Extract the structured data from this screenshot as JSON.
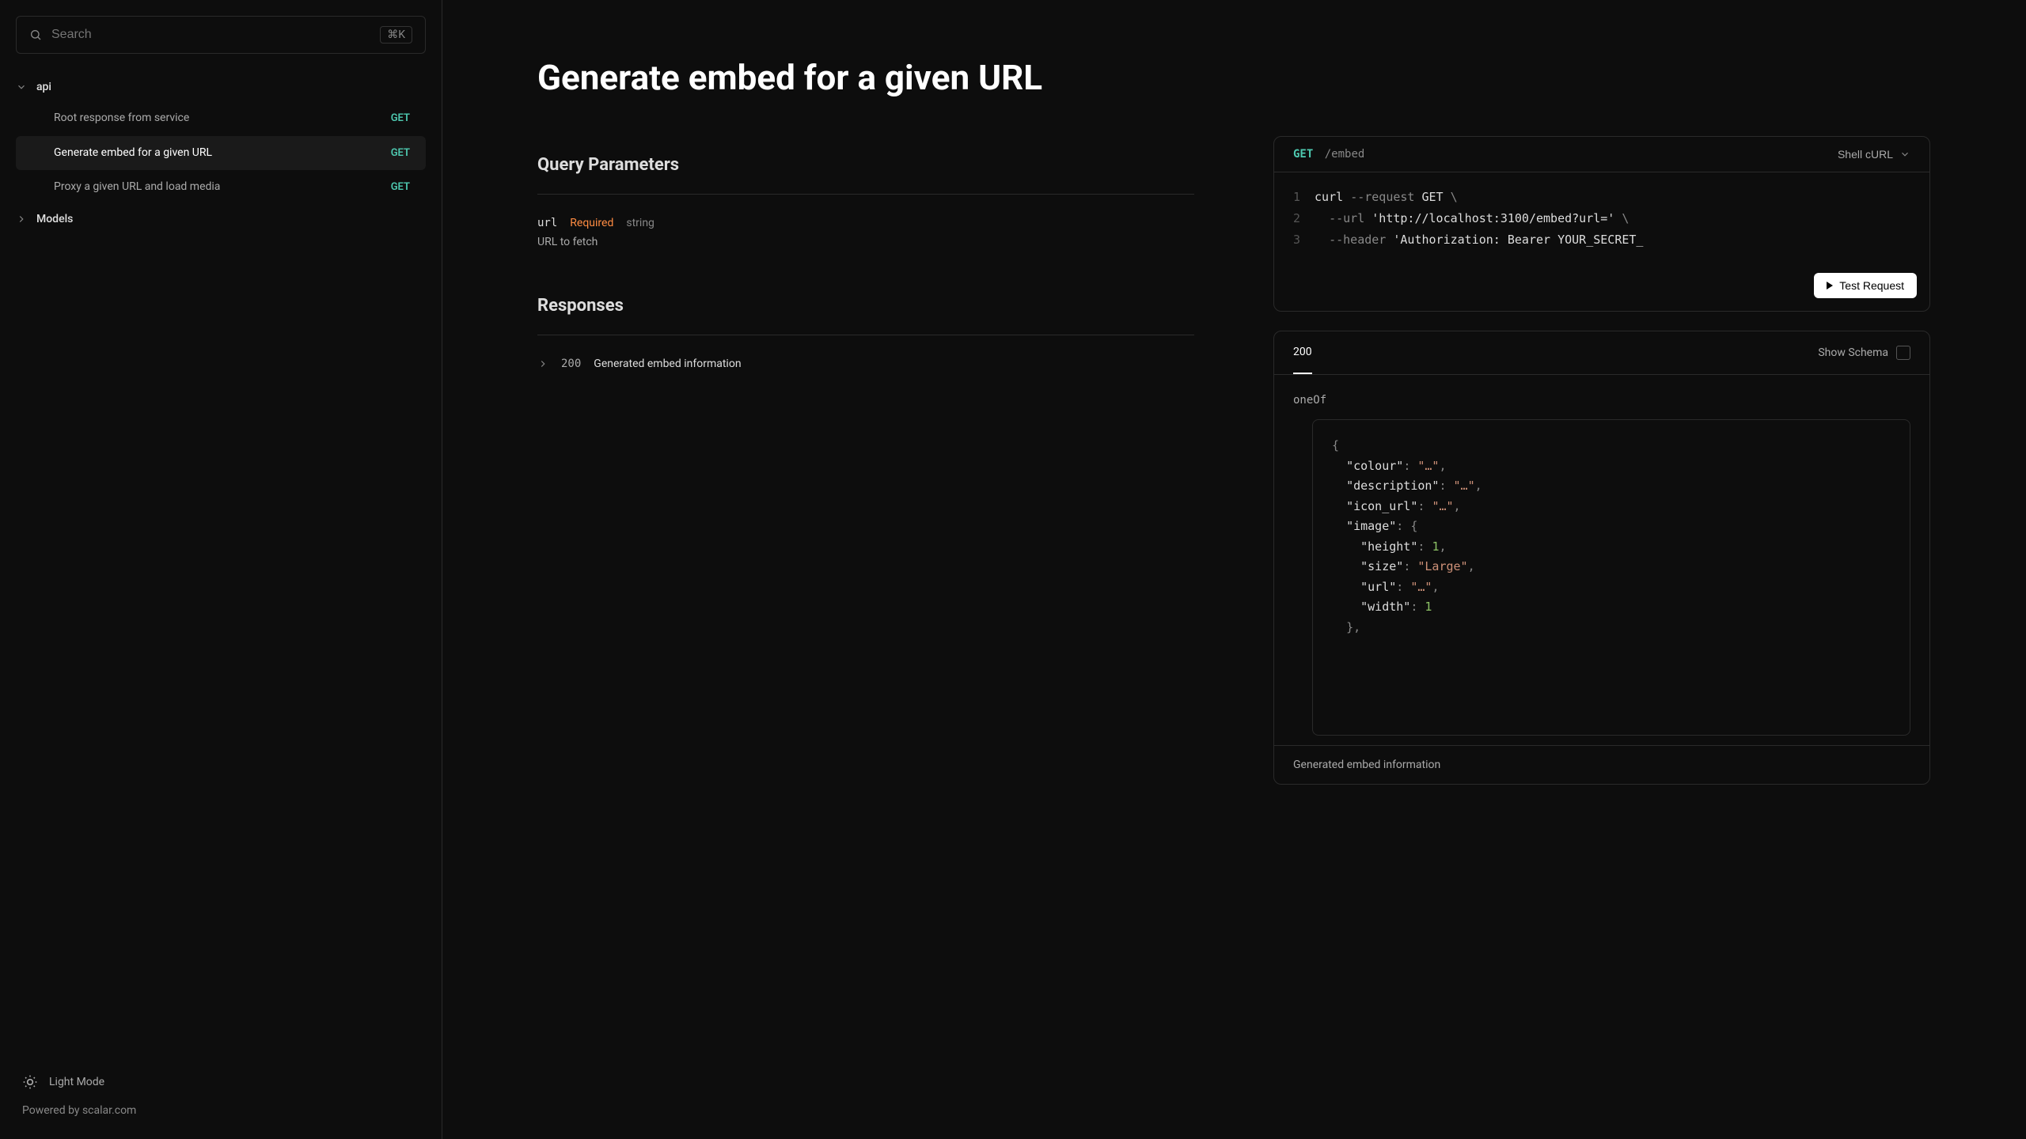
{
  "sidebar": {
    "search_placeholder": "Search",
    "search_shortcut": "⌘K",
    "group_label": "api",
    "items": [
      {
        "label": "Root response from service",
        "method": "GET"
      },
      {
        "label": "Generate embed for a given URL",
        "method": "GET"
      },
      {
        "label": "Proxy a given URL and load media",
        "method": "GET"
      }
    ],
    "models_label": "Models",
    "light_mode": "Light Mode",
    "powered_by": "Powered by scalar.com"
  },
  "page": {
    "title": "Generate embed for a given URL",
    "query_params_heading": "Query Parameters",
    "param_name": "url",
    "param_required": "Required",
    "param_type": "string",
    "param_desc": "URL to fetch",
    "responses_heading": "Responses",
    "response_code": "200",
    "response_desc": "Generated embed information"
  },
  "request": {
    "method": "GET",
    "path": "/embed",
    "lang": "Shell cURL",
    "lines": {
      "n1": "1",
      "n2": "2",
      "n3": "3",
      "cmd": "curl",
      "flag_request": "--request",
      "get_kw": "GET",
      "bs": "\\",
      "flag_url": "--url",
      "url_val": "'http://localhost:3100/embed?url='",
      "flag_header": "--header",
      "header_val": "'Authorization: Bearer YOUR_SECRET_"
    },
    "test_btn": "Test Request"
  },
  "schema": {
    "tab": "200",
    "show_schema": "Show Schema",
    "oneof": "oneOf",
    "json": {
      "open_brace": "{",
      "colour_k": "\"colour\"",
      "ellip_str": "\"…\"",
      "desc_k": "\"description\"",
      "icon_k": "\"icon_url\"",
      "image_k": "\"image\"",
      "height_k": "\"height\"",
      "one": "1",
      "size_k": "\"size\"",
      "large": "\"Large\"",
      "url_k": "\"url\"",
      "width_k": "\"width\"",
      "close_brace": "}"
    },
    "footer": "Generated embed information"
  }
}
